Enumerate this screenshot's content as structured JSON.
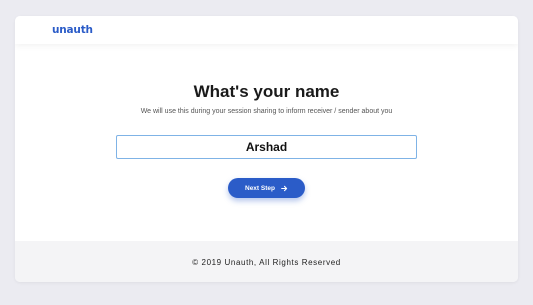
{
  "header": {
    "logo": "unauth"
  },
  "main": {
    "title": "What's your name",
    "subtitle": "We will use this during your session sharing to inform receiver / sender about you",
    "name_input_value": "Arshad",
    "next_button_label": "Next Step",
    "next_button_icon": "arrow-right-icon"
  },
  "footer": {
    "copyright": "© 2019 Unauth, All Rights Reserved"
  },
  "colors": {
    "accent": "#2b5cc8",
    "background": "#ebebf1",
    "input_border": "#7fb3e6",
    "footer_bg": "#f4f4f6"
  }
}
